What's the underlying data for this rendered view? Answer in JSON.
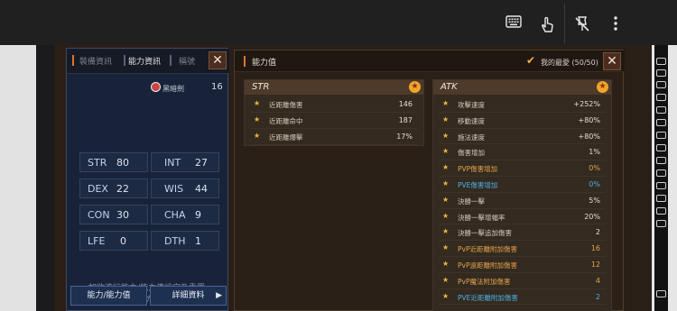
{
  "toolbar": {
    "icons": [
      "keyboard-icon",
      "touch-icon",
      "pin-off-icon",
      "more-vert-icon"
    ]
  },
  "left_panel": {
    "tabs": [
      {
        "label": "裝備資訊"
      },
      {
        "label": "能力資訊"
      },
      {
        "label": "稱號"
      }
    ],
    "class_label": "黑暗劍",
    "level": "16",
    "stats": [
      {
        "name": "STR",
        "value": "80"
      },
      {
        "name": "INT",
        "value": "27"
      },
      {
        "name": "DEX",
        "value": "22"
      },
      {
        "name": "WIS",
        "value": "44"
      },
      {
        "name": "CON",
        "value": "30"
      },
      {
        "name": "CHA",
        "value": "9"
      },
      {
        "name": "LFE",
        "value": "0"
      },
      {
        "name": "DTH",
        "value": "1"
      }
    ],
    "hint_line1": "如欲進行能力/能力值設定及重置,",
    "hint_line2": "請點擊下方能力/能力值按鈕.",
    "button_ability": "能力/能力值",
    "button_details": "詳細資料"
  },
  "right_panel": {
    "title": "能力值",
    "favorites_label": "我的最愛 (50/50)",
    "str_section": {
      "title": "STR",
      "rows": [
        {
          "label": "近距離傷害",
          "value": "146"
        },
        {
          "label": "近距離命中",
          "value": "187"
        },
        {
          "label": "近距離爆擊",
          "value": "17%"
        }
      ]
    },
    "atk_section": {
      "title": "ATK",
      "rows": [
        {
          "label": "攻擊速度",
          "value": "+252%",
          "color": "#d7ccbd"
        },
        {
          "label": "移動速度",
          "value": "+80%",
          "color": "#d7ccbd"
        },
        {
          "label": "施法速度",
          "value": "+80%",
          "color": "#d7ccbd"
        },
        {
          "label": "傷害增加",
          "value": "1%",
          "color": "#d7ccbd"
        },
        {
          "label": "PVP傷害增加",
          "value": "0%",
          "color": "#e8a34a"
        },
        {
          "label": "PVE傷害增加",
          "value": "0%",
          "color": "#4fb0e6"
        },
        {
          "label": "決勝一擊",
          "value": "5%",
          "color": "#d7ccbd"
        },
        {
          "label": "決勝一擊增幅率",
          "value": "20%",
          "color": "#d7ccbd"
        },
        {
          "label": "決勝一擊追加傷害",
          "value": "2",
          "color": "#d7ccbd"
        },
        {
          "label": "PvP近距離附加傷害",
          "value": "16",
          "color": "#e8a34a"
        },
        {
          "label": "PvP遠距離附加傷害",
          "value": "12",
          "color": "#e8a34a"
        },
        {
          "label": "PvP魔法附加傷害",
          "value": "4",
          "color": "#e8a34a"
        },
        {
          "label": "PVE近距離附加傷害",
          "value": "2",
          "color": "#4fb0e6"
        }
      ]
    }
  },
  "colors": {
    "accent_gold": "#f2a42b",
    "pvp_orange": "#e8a34a",
    "pve_blue": "#4fb0e6"
  }
}
